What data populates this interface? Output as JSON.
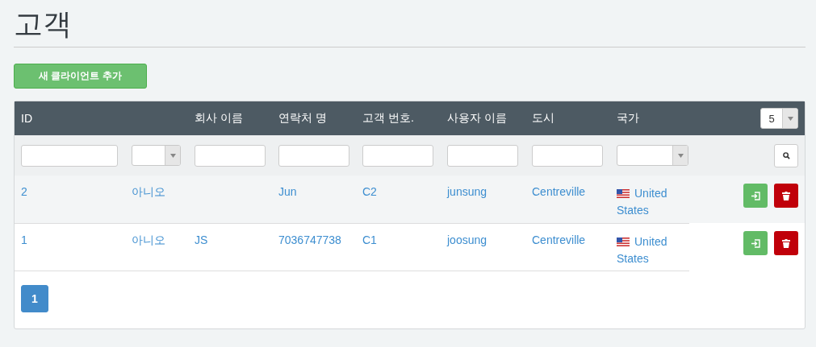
{
  "title": "고객",
  "add_button": "새 클라이언트 추가",
  "table": {
    "columns": [
      {
        "label": "ID",
        "kind": "text"
      },
      {
        "kind": "select"
      },
      {
        "label": "회사 이름",
        "kind": "text"
      },
      {
        "label": "연락처 명",
        "kind": "text"
      },
      {
        "label": "고객 번호.",
        "kind": "text"
      },
      {
        "label": "사용자 이름",
        "kind": "text"
      },
      {
        "label": "도시",
        "kind": "text"
      },
      {
        "label": "국가",
        "kind": "select"
      }
    ],
    "page_size": "5",
    "rows": [
      {
        "id": "2",
        "column_2": "아니오",
        "contact": "Jun",
        "customer_no": "C2",
        "username": "junsung",
        "city": "Centreville",
        "country": "United States"
      },
      {
        "id": "1",
        "column_2": "아니오",
        "company": "JS",
        "contact": "7036747738",
        "customer_no": "C1",
        "username": "joosung",
        "city": "Centreville",
        "country": "United States"
      }
    ]
  },
  "pagination": [
    {
      "label": "1",
      "selected": true
    }
  ]
}
